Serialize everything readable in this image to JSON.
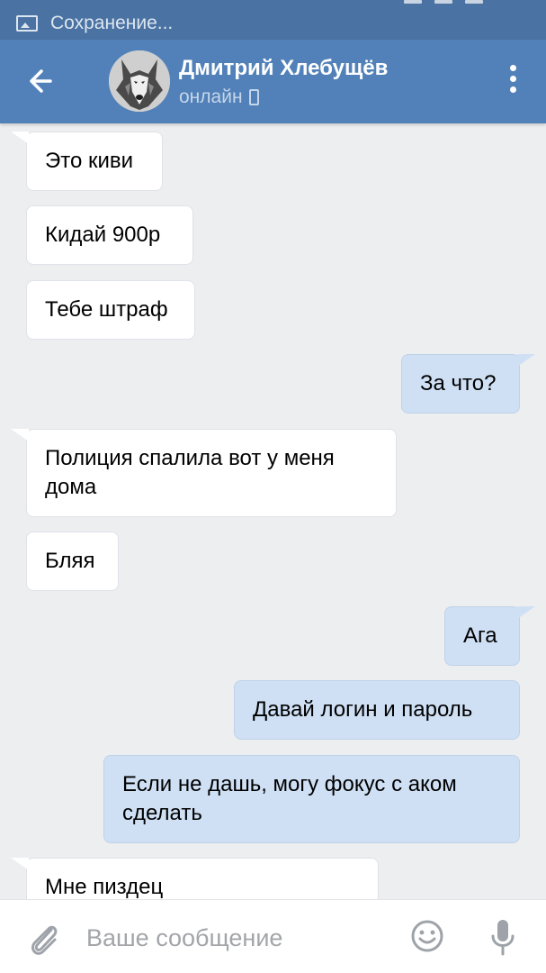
{
  "status_bar": {
    "text": "Сохранение...",
    "icon": "image-icon"
  },
  "header": {
    "contact_name": "Дмитрий Хлебущёв",
    "status": "онлайн",
    "back_icon": "arrow-left-icon",
    "menu_icon": "more-vertical-icon",
    "status_device_icon": "mobile-phone-icon"
  },
  "messages": [
    {
      "direction": "in",
      "text": "Это киви"
    },
    {
      "direction": "in",
      "text": "Кидай 900р"
    },
    {
      "direction": "in",
      "text": "Тебе штраф"
    },
    {
      "direction": "out",
      "text": "За что?"
    },
    {
      "direction": "in",
      "text": "Полиция спалила вот у меня дома"
    },
    {
      "direction": "in",
      "text": "Бляя"
    },
    {
      "direction": "out",
      "text": "Ага"
    },
    {
      "direction": "out",
      "text": "Давай логин и пароль"
    },
    {
      "direction": "out",
      "text": "Если не дашь, могу фокус с аком сделать"
    },
    {
      "direction": "in",
      "text": "Мне пиздец"
    }
  ],
  "composer": {
    "placeholder": "Ваше сообщение",
    "attach_icon": "paperclip-icon",
    "emoji_icon": "smiley-icon",
    "mic_icon": "microphone-icon"
  },
  "colors": {
    "header_bg": "#5181b8",
    "statusbar_bg": "#4a72a2",
    "chat_bg": "#edeef0",
    "incoming_bubble": "#ffffff",
    "outgoing_bubble": "#cfe0f4"
  }
}
